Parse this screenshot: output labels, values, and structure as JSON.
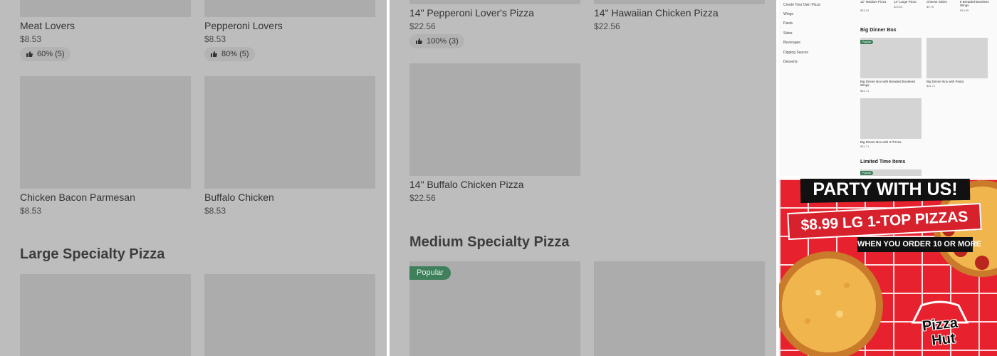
{
  "panel1": {
    "items_top": [
      {
        "name": "Meat Lovers",
        "price": "$8.53",
        "rating": "60% (5)"
      },
      {
        "name": "Pepperoni Lovers",
        "price": "$8.53",
        "rating": "80% (5)"
      }
    ],
    "items_mid": [
      {
        "name": "Chicken Bacon Parmesan",
        "price": "$8.53"
      },
      {
        "name": "Buffalo Chicken",
        "price": "$8.53"
      }
    ],
    "section_title": "Large Specialty Pizza"
  },
  "panel2": {
    "items_top": [
      {
        "name": "14\" Pepperoni Lover's Pizza",
        "price": "$22.56",
        "rating": "100% (3)"
      },
      {
        "name": "14\" Hawaiian Chicken Pizza",
        "price": "$22.56"
      }
    ],
    "item_mid": {
      "name": "14\" Buffalo Chicken Pizza",
      "price": "$22.56"
    },
    "section_title": "Medium Specialty Pizza",
    "popular_label": "Popular"
  },
  "panel3": {
    "categories": [
      "Create Your Own Pizza",
      "Wings",
      "Pasta",
      "Sides",
      "Beverages",
      "Dipping Sauces",
      "Desserts"
    ],
    "top_items": [
      {
        "name": "12\" Medium Pizza",
        "price": "$23.24"
      },
      {
        "name": "14\" Large Pizza",
        "price": "$23.03"
      },
      {
        "name": "Cheese Sticks",
        "price": "$9.75"
      },
      {
        "name": "8 Breaded Boneless Wings",
        "price": "$10.59"
      }
    ],
    "section_dinner": "Big Dinner Box",
    "popular_label": "Popular",
    "dinner_items": [
      {
        "name": "Big Dinner Box with Breaded Boneless Wings",
        "price": "$31.71"
      },
      {
        "name": "Big Dinner Box with Pasta",
        "price": "$31.71"
      },
      {
        "name": "Big Dinner Box with 3 Pizzas",
        "price": "$31.71"
      }
    ],
    "section_limited": "Limited Time Items"
  },
  "ad": {
    "headline": "PARTY WITH US!",
    "offer": "$8.99 LG 1-TOP PIZZAS",
    "condition": "WHEN YOU ORDER 10 OR MORE",
    "brand_line1": "Pizza",
    "brand_line2": "Hut",
    "colors": {
      "red": "#e8212e",
      "black": "#111111",
      "white": "#ffffff"
    }
  },
  "colors": {
    "overlay": "#bdbdbd",
    "popular_green": "#3f7f5c"
  }
}
